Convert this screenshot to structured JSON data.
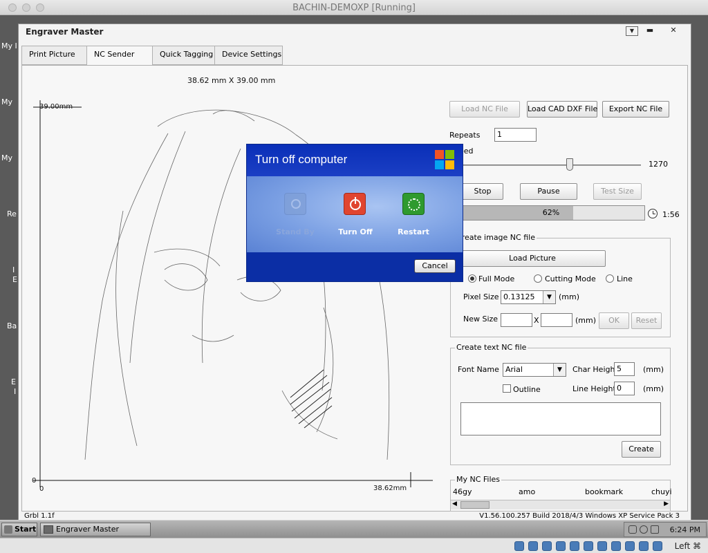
{
  "host": {
    "title": "BACHIN-DEMOXP [Running]",
    "host_key": "Left ⌘"
  },
  "desktop": {
    "labels": [
      "My I",
      "My",
      "My",
      "Re",
      "I",
      "E",
      "Ba",
      "E",
      "I"
    ]
  },
  "window": {
    "title": "Engraver Master",
    "tabs": [
      {
        "label": "Print Picture"
      },
      {
        "label": "NC Sender"
      },
      {
        "label": "Quick Tagging"
      },
      {
        "label": "Device Settings"
      }
    ],
    "active_tab": "NC Sender"
  },
  "canvas": {
    "dimension_label": "38.62 mm X 39.00 mm",
    "y_max_label": "39.00mm",
    "x_max_label": "38.62mm",
    "y_origin_label": "0",
    "x_origin_label": "0"
  },
  "nc_sender": {
    "load_nc_file": "Load NC File",
    "load_cad_dxf": "Load CAD DXF File",
    "export_nc_file": "Export NC File",
    "repeats_label": "Repeats",
    "repeats_value": "1",
    "speed_label": "Speed",
    "speed_value": "1270",
    "stop": "Stop",
    "pause": "Pause",
    "test_size": "Test Size",
    "progress_value": 62,
    "progress_text": "62%",
    "time_remaining": "1:56"
  },
  "image_nc": {
    "group_title": "Create image NC file",
    "load_picture": "Load Picture",
    "modes": [
      "Full Mode",
      "Cutting Mode",
      "Line"
    ],
    "selected_mode": "Full Mode",
    "pixel_size_label": "Pixel Size",
    "pixel_size_value": "0.13125",
    "mm_unit": "(mm)",
    "new_size_label": "New Size",
    "x_separator": "X",
    "ok": "OK",
    "reset": "Reset"
  },
  "text_nc": {
    "group_title": "Create text NC file",
    "font_name_label": "Font Name",
    "font_value": "Arial",
    "char_height_label": "Char Height",
    "char_height_value": "5",
    "line_height_label": "Line Height",
    "line_height_value": "0",
    "mm_unit": "(mm)",
    "outline_label": "Outline",
    "create": "Create"
  },
  "my_nc_files": {
    "group_title": "My NC Files",
    "files": [
      "46gy",
      "amo",
      "bookmark",
      "chuyi"
    ]
  },
  "status": {
    "left": "Grbl 1.1f",
    "right": "V1.56.100.257 Build 2018/4/3 Windows XP Service Pack 3"
  },
  "taskbar": {
    "start": "Start",
    "task": "Engraver Master",
    "clock": "6:24 PM"
  },
  "turn_off_dialog": {
    "title": "Turn off computer",
    "options": [
      {
        "label": "Stand By",
        "enabled": false,
        "icon": "standby-icon",
        "color": "#7f9fd6"
      },
      {
        "label": "Turn Off",
        "enabled": true,
        "icon": "power-icon",
        "color": "#e0452f"
      },
      {
        "label": "Restart",
        "enabled": true,
        "icon": "restart-icon",
        "color": "#2f9a2f"
      }
    ],
    "cancel": "Cancel"
  },
  "colors": {
    "xp_blue": "#0b2ea5",
    "turn_off_red": "#e0452f",
    "restart_green": "#2f9a2f"
  }
}
